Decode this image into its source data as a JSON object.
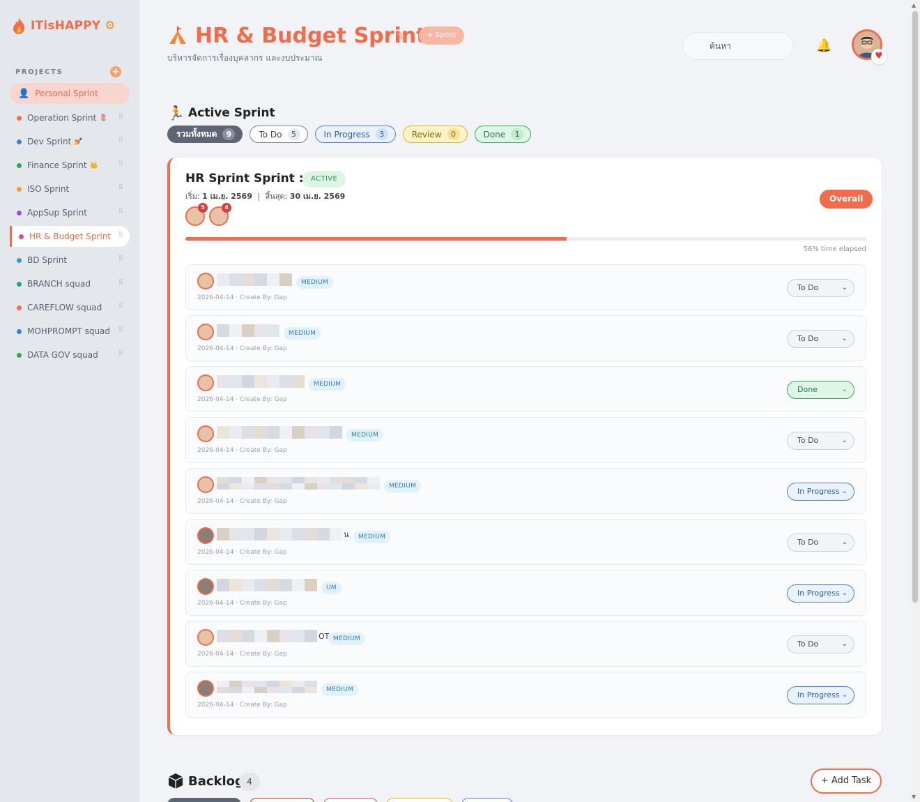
{
  "brand": {
    "name": "ITisHAPPY"
  },
  "sidebar": {
    "projects_label": "PROJECTS",
    "personal": "Personal Sprint",
    "items": [
      {
        "label": "Operation Sprint",
        "color": "#f26b4a",
        "emoji": "🌷"
      },
      {
        "label": "Dev Sprint",
        "color": "#3b7ee0",
        "emoji": "💅"
      },
      {
        "label": "Finance Sprint",
        "color": "#27a85a",
        "emoji": "👑"
      },
      {
        "label": "ISO Sprint",
        "color": "#f0a020",
        "emoji": ""
      },
      {
        "label": "AppSup Sprint",
        "color": "#9b4fd8",
        "emoji": ""
      },
      {
        "label": "HR & Budget Sprint",
        "color": "#e0489a",
        "emoji": ""
      },
      {
        "label": "BD Sprint",
        "color": "#2e9ae0",
        "emoji": ""
      },
      {
        "label": "BRANCH squad",
        "color": "#1fa38a",
        "emoji": ""
      },
      {
        "label": "CAREFLOW squad",
        "color": "#f26b4a",
        "emoji": ""
      },
      {
        "label": "MOHPROMPT squad",
        "color": "#3b7ee0",
        "emoji": ""
      },
      {
        "label": "DATA GOV squad",
        "color": "#27a85a",
        "emoji": ""
      }
    ]
  },
  "header": {
    "title": "HR & Budget Sprint",
    "sprint_button": "+ Sprint",
    "subtitle": "บริหารจัดการเรื่องบุคลากร และงบประมาณ",
    "search_placeholder": "ค้นหา"
  },
  "active_sprint": {
    "heading": "Active Sprint",
    "filters": [
      {
        "label": "รวมทั้งหมด",
        "count": "9"
      },
      {
        "label": "To Do",
        "count": "5"
      },
      {
        "label": "In Progress",
        "count": "3"
      },
      {
        "label": "Review",
        "count": "0"
      },
      {
        "label": "Done",
        "count": "1"
      }
    ]
  },
  "sprint_card": {
    "title": "HR Sprint Sprint : 1",
    "status": "ACTIVE",
    "start_label": "เริ่ม:",
    "start_date": "1 เม.ย. 2569",
    "separator": "|",
    "end_label": "สิ้นสุด:",
    "end_date": "30 เม.ย. 2569",
    "members": [
      {
        "count": "5"
      },
      {
        "count": "4"
      }
    ],
    "overall_button": "Overall",
    "time_elapsed_pct": 56,
    "time_elapsed_text": "56% time elapsed"
  },
  "tasks": [
    {
      "priority": "MEDIUM",
      "meta": "2026-04-14 · Create By: Gap",
      "status": "To Do",
      "suffix": ""
    },
    {
      "priority": "MEDIUM",
      "meta": "2026-04-14 · Create By: Gap",
      "status": "To Do",
      "suffix": ""
    },
    {
      "priority": "MEDIUM",
      "meta": "2026-04-14 · Create By: Gap",
      "status": "Done",
      "suffix": ""
    },
    {
      "priority": "MEDIUM",
      "meta": "2026-04-14 · Create By: Gap",
      "status": "To Do",
      "suffix": ""
    },
    {
      "priority": "MEDIUM",
      "meta": "2026-04-14 · Create By: Gap",
      "status": "In Progress",
      "suffix": ""
    },
    {
      "priority": "MEDIUM",
      "meta": "2026-04-14 · Create By: Gap",
      "status": "To Do",
      "suffix": "น"
    },
    {
      "priority": "UM",
      "meta": "2026-04-14 · Create By: Gap",
      "status": "In Progress",
      "suffix": ""
    },
    {
      "priority": "MEDIUM",
      "meta": "2026-04-14 · Create By: Gap",
      "status": "To Do",
      "suffix": "OT"
    },
    {
      "priority": "MEDIUM",
      "meta": "2026-04-14 · Create By: Gap",
      "status": "In Progress",
      "suffix": ""
    }
  ],
  "backlog": {
    "heading": "Backlog",
    "count": "4",
    "add_button": "+ Add Task"
  },
  "colors": {
    "accent": "#f26b4a",
    "done": "#3aa35f",
    "progress": "#4f7fd0",
    "review": "#d9b51e"
  },
  "icons": {
    "brand": "flame-icon",
    "settings": "gear-icon",
    "edit": "pencil-icon",
    "bell": "bell-icon",
    "active": "runner-icon",
    "backlog": "box-icon"
  }
}
